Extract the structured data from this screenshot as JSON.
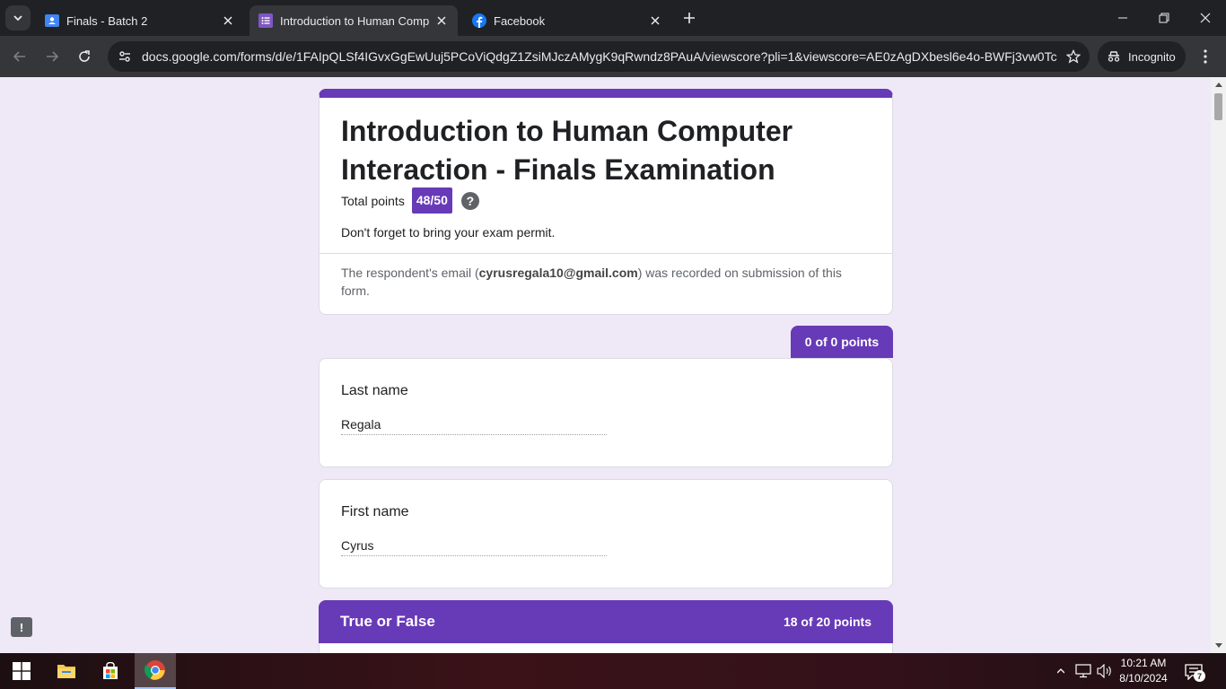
{
  "browser": {
    "tabs": [
      {
        "title": "Finals - Batch 2",
        "active": false
      },
      {
        "title": "Introduction to Human Computer Interaction - Finals Examination",
        "active": true
      },
      {
        "title": "Facebook",
        "active": false
      }
    ],
    "url": "docs.google.com/forms/d/e/1FAIpQLSf4IGvxGgEwUuj5PCoViQdgZ1ZsiMJczAMygK9qRwndz8PAuA/viewscore?pli=1&viewscore=AE0zAgDXbesl6e4o-BWFj3vw0Tc...",
    "incognito_label": "Incognito",
    "accent": "#202124"
  },
  "form": {
    "title": "Introduction to Human Computer Interaction - Finals Examination",
    "total_points_label": "Total points",
    "score": "48/50",
    "help_glyph": "?",
    "description": "Don't forget to bring your exam permit.",
    "email_note_prefix": "The respondent's email (",
    "email": "cyrusregala10@gmail.com",
    "email_note_suffix": ") was recorded on submission of this form.",
    "accent_color": "#673ab7"
  },
  "section1": {
    "points": "0 of 0 points",
    "questions": [
      {
        "label": "Last name",
        "answer": "Regala"
      },
      {
        "label": "First name",
        "answer": "Cyrus"
      }
    ]
  },
  "section2": {
    "title": "True or False",
    "points": "18 of 20 points"
  },
  "feedback_glyph": "!",
  "taskbar": {
    "time": "10:21 AM",
    "date": "8/10/2024",
    "notification_count": "7"
  }
}
